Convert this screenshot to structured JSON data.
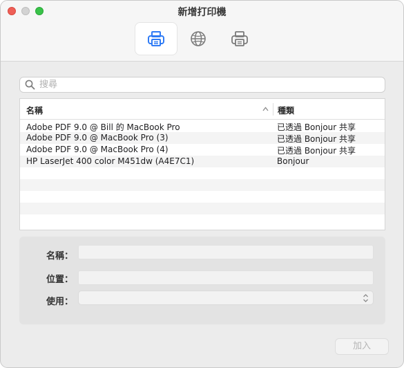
{
  "window": {
    "title": "新增打印機"
  },
  "toolbar": [
    {
      "icon": "default-printer-icon",
      "active": true
    },
    {
      "icon": "ip-globe-icon",
      "active": false
    },
    {
      "icon": "windows-printer-icon",
      "active": false
    }
  ],
  "search": {
    "placeholder": "搜尋",
    "value": ""
  },
  "table": {
    "columns": {
      "name": "名稱",
      "kind": "種類"
    },
    "sort": "ascending",
    "rows": [
      {
        "name": "Adobe PDF 9.0 @ Bill 的 MacBook Pro",
        "kind": "已透過 Bonjour 共享"
      },
      {
        "name": "Adobe PDF 9.0 @ MacBook Pro (3)",
        "kind": "已透過 Bonjour 共享"
      },
      {
        "name": "Adobe PDF 9.0 @ MacBook Pro (4)",
        "kind": "已透過 Bonjour 共享"
      },
      {
        "name": "HP LaserJet 400 color M451dw (A4E7C1)",
        "kind": "Bonjour"
      }
    ]
  },
  "form": {
    "name_label": "名稱：",
    "name_value": "",
    "location_label": "位置：",
    "location_value": "",
    "use_label": "使用：",
    "use_value": ""
  },
  "footer": {
    "add_label": "加入"
  },
  "colors": {
    "close": "#ee5f57",
    "minimize": "#d3d3d3",
    "zoom": "#39c249"
  }
}
